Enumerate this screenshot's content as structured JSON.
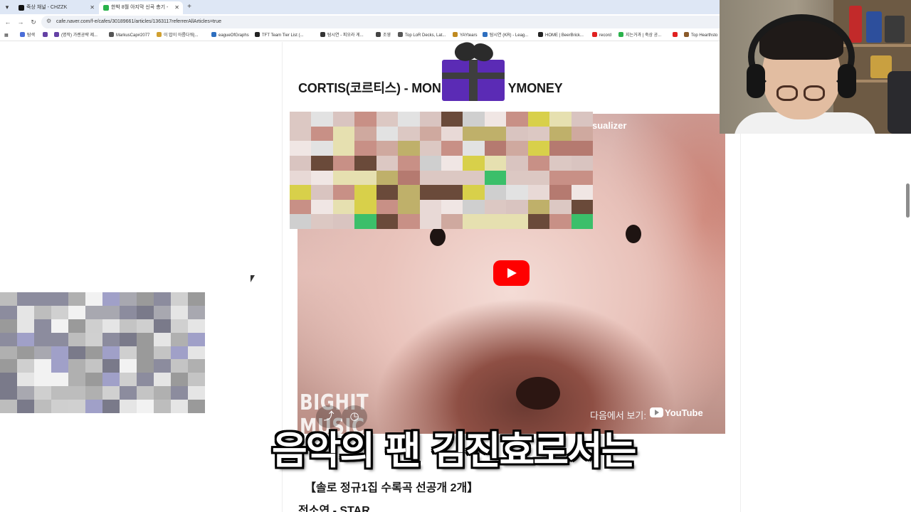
{
  "browser": {
    "tabs": [
      {
        "title": "죽상 채널 - CHZZK",
        "active": false,
        "favicon_color": "#111111"
      },
      {
        "title": "한박 8월 아지막 신곡 총기 -",
        "active": true,
        "favicon_color": "#2ab24b"
      }
    ],
    "url": "cafe.naver.com/f-e/cafes/30189661/articles/1363117referrerAllArticles=true",
    "bookmarks": [
      {
        "label": "탐색",
        "color": "#4a6dd8"
      },
      {
        "label": "",
        "color": "#6441a5"
      },
      {
        "label": "(명작) 가렌공략 제...",
        "color": "#6441a5"
      },
      {
        "label": "MarkusCap#2077",
        "color": "#555555"
      },
      {
        "label": "이 밥이 아름다워|...",
        "color": "#d0a030"
      },
      {
        "label": "eagueOfGraphs",
        "color": "#2e6fbf"
      },
      {
        "label": "TFT Team Tier List (...",
        "color": "#222222"
      },
      {
        "label": "탐시연 - 피오라 게...",
        "color": "#333333"
      },
      {
        "label": "조영",
        "color": "#444444"
      },
      {
        "label": "Top LoR Decks, Lat...",
        "color": "#555555"
      },
      {
        "label": "YAYtears",
        "color": "#c08a20"
      },
      {
        "label": "탐시연 (KR) - Leag...",
        "color": "#2e6fbf"
      },
      {
        "label": "HOME | BeerBrick...",
        "color": "#222222"
      },
      {
        "label": "record",
        "color": "#e02020"
      },
      {
        "label": "지는거과 | 죽상 공...",
        "color": "#2ab24b"
      },
      {
        "label": "",
        "color": "#e02020"
      },
      {
        "label": "Top Hearthsto",
        "color": "#8a5a2a"
      }
    ]
  },
  "post": {
    "title": "CORTIS(코르티스) - MON",
    "title_tail": "YMONEY",
    "section_heading": "【솔로 정규1집 수록곡 선공개 2개】",
    "next_line": "전소연 - STAR"
  },
  "video": {
    "title_fragment": "sualizer",
    "brand": "BIGHIT\nMUSIC",
    "watch_on_label": "다음에서 보기:",
    "youtube_label": "YouTube",
    "share_icon": "share-icon",
    "clock_icon": "watch-later-icon"
  },
  "subtitle": "음악의 팬 김진효로서는",
  "colors": {
    "play_red": "#ff0000",
    "gift_purple": "#5b2bb5",
    "naver_green": "#2ab24b"
  }
}
